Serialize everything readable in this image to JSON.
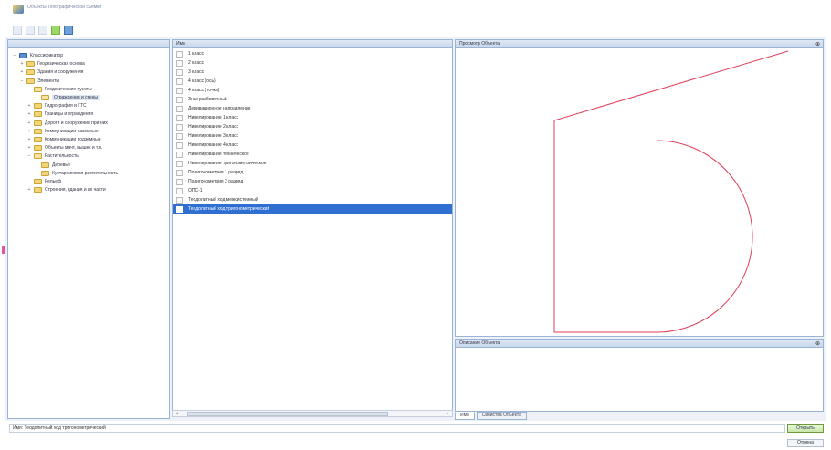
{
  "window": {
    "title": "Объекты Топографической съёмки"
  },
  "toolbar": {
    "icons": [
      "open-icon",
      "view-icon",
      "arrow-icon",
      "color-grid-icon"
    ]
  },
  "tree": {
    "items": [
      {
        "label": "Классификатор",
        "level": 0,
        "toggle": "−",
        "icon": "root"
      },
      {
        "label": "Геодезическая основа",
        "level": 1,
        "toggle": "+",
        "icon": "folder"
      },
      {
        "label": "Здания и сооружения",
        "level": 1,
        "toggle": "+",
        "icon": "folder"
      },
      {
        "label": "Элементы",
        "level": 1,
        "toggle": "−",
        "icon": "folder"
      },
      {
        "label": "Геодезические пункты",
        "level": 2,
        "toggle": "−",
        "icon": "open"
      },
      {
        "label": "Ограждения и стены",
        "level": 3,
        "toggle": "",
        "icon": "open",
        "selected": true
      },
      {
        "label": "Гидрография и ГТС",
        "level": 2,
        "toggle": "+",
        "icon": "folder"
      },
      {
        "label": "Границы и ограждения",
        "level": 2,
        "toggle": "+",
        "icon": "folder"
      },
      {
        "label": "Дороги и сооружения при них",
        "level": 2,
        "toggle": "+",
        "icon": "folder"
      },
      {
        "label": "Коммуникации наземные",
        "level": 2,
        "toggle": "+",
        "icon": "folder"
      },
      {
        "label": "Коммуникации подземные",
        "level": 2,
        "toggle": "+",
        "icon": "folder"
      },
      {
        "label": "Объекты мачт, вышек и т.п.",
        "level": 2,
        "toggle": "+",
        "icon": "folder"
      },
      {
        "label": "Растительность",
        "level": 2,
        "toggle": "−",
        "icon": "open"
      },
      {
        "label": "Деревья",
        "level": 3,
        "toggle": "",
        "icon": "folder"
      },
      {
        "label": "Кустарниковая растительность",
        "level": 3,
        "toggle": "",
        "icon": "folder"
      },
      {
        "label": "Рельеф",
        "level": 2,
        "toggle": "",
        "icon": "folder"
      },
      {
        "label": "Строения, здания и их части",
        "level": 2,
        "toggle": "+",
        "icon": "folder"
      }
    ]
  },
  "list": {
    "header": "Имя",
    "rows": [
      {
        "label": "1 класс"
      },
      {
        "label": "2 класс"
      },
      {
        "label": "3 класс"
      },
      {
        "label": "4 класс (ось)"
      },
      {
        "label": "4 класс (точка)"
      },
      {
        "label": "Знак разбивочный"
      },
      {
        "label": "Деривационное направление"
      },
      {
        "label": "Нивелирование 1 класс"
      },
      {
        "label": "Нивелирование 2 класс"
      },
      {
        "label": "Нивелирование 3 класс"
      },
      {
        "label": "Нивелирование 4 класс"
      },
      {
        "label": "Нивелирование техническое"
      },
      {
        "label": "Нивелирование тригонометрическое"
      },
      {
        "label": "Полигонометрия 1 разряд"
      },
      {
        "label": "Полигонометрия 2 разряд"
      },
      {
        "label": "ОПС-1"
      },
      {
        "label": "Теодолитный ход межсистемный"
      },
      {
        "label": "Теодолитный ход тригонометрический",
        "selected": true
      }
    ]
  },
  "preview": {
    "header": "Просмотр Объекта",
    "pin": "⊕"
  },
  "description": {
    "header": "Описание Объекта",
    "pin": "⊕",
    "tabs": [
      "Имя",
      "Свойства Объекта"
    ]
  },
  "status": {
    "field": "Имя: Теодолитный ход тригонометрический",
    "ok": "Открыть",
    "cancel": "Отмена"
  },
  "colors": {
    "selection": "#2f6fd1",
    "shape": "#e0405a",
    "panel_border": "#9ab4d6"
  }
}
